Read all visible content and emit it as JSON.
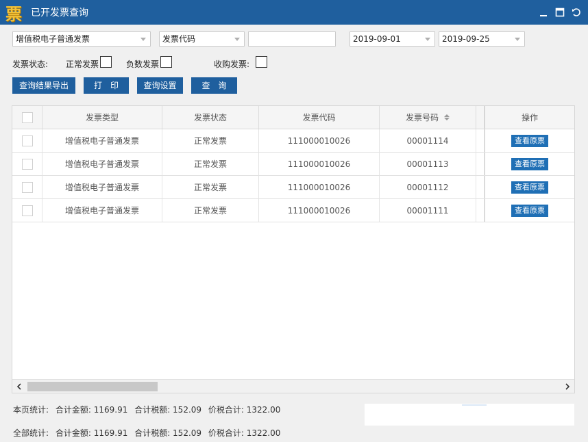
{
  "window": {
    "logo_char": "票",
    "title": "已开发票查询"
  },
  "filters": {
    "invoice_type": "增值税电子普通发票",
    "field_select": "发票代码",
    "field_value": "",
    "date_from": "2019-09-01",
    "date_to": "2019-09-25"
  },
  "status": {
    "label": "发票状态:",
    "normal_label": "正常发票",
    "negative_label": "负数发票",
    "purchase_label": "收购发票:"
  },
  "buttons": {
    "export": "查询结果导出",
    "print": "打　印",
    "settings": "查询设置",
    "query": "查　询"
  },
  "table": {
    "columns": [
      "发票类型",
      "发票状态",
      "发票代码",
      "发票号码",
      "操作"
    ],
    "rows": [
      {
        "type": "增值税电子普通发票",
        "status": "正常发票",
        "code": "111000010026",
        "number": "00001114",
        "action": "查看原票"
      },
      {
        "type": "增值税电子普通发票",
        "status": "正常发票",
        "code": "111000010026",
        "number": "00001113",
        "action": "查看原票"
      },
      {
        "type": "增值税电子普通发票",
        "status": "正常发票",
        "code": "111000010026",
        "number": "00001112",
        "action": "查看原票"
      },
      {
        "type": "增值税电子普通发票",
        "status": "正常发票",
        "code": "111000010026",
        "number": "00001111",
        "action": "查看原票"
      }
    ]
  },
  "summary": {
    "page": {
      "label": "本页统计:",
      "amount": "合计金额:  1169.91",
      "tax": "合计税额:  152.09",
      "total": "价税合计:  1322.00"
    },
    "all": {
      "label": "全部统计:",
      "amount": "合计金额:  1169.91",
      "tax": "合计税额:  152.09",
      "total": "价税合计:  1322.00"
    }
  }
}
